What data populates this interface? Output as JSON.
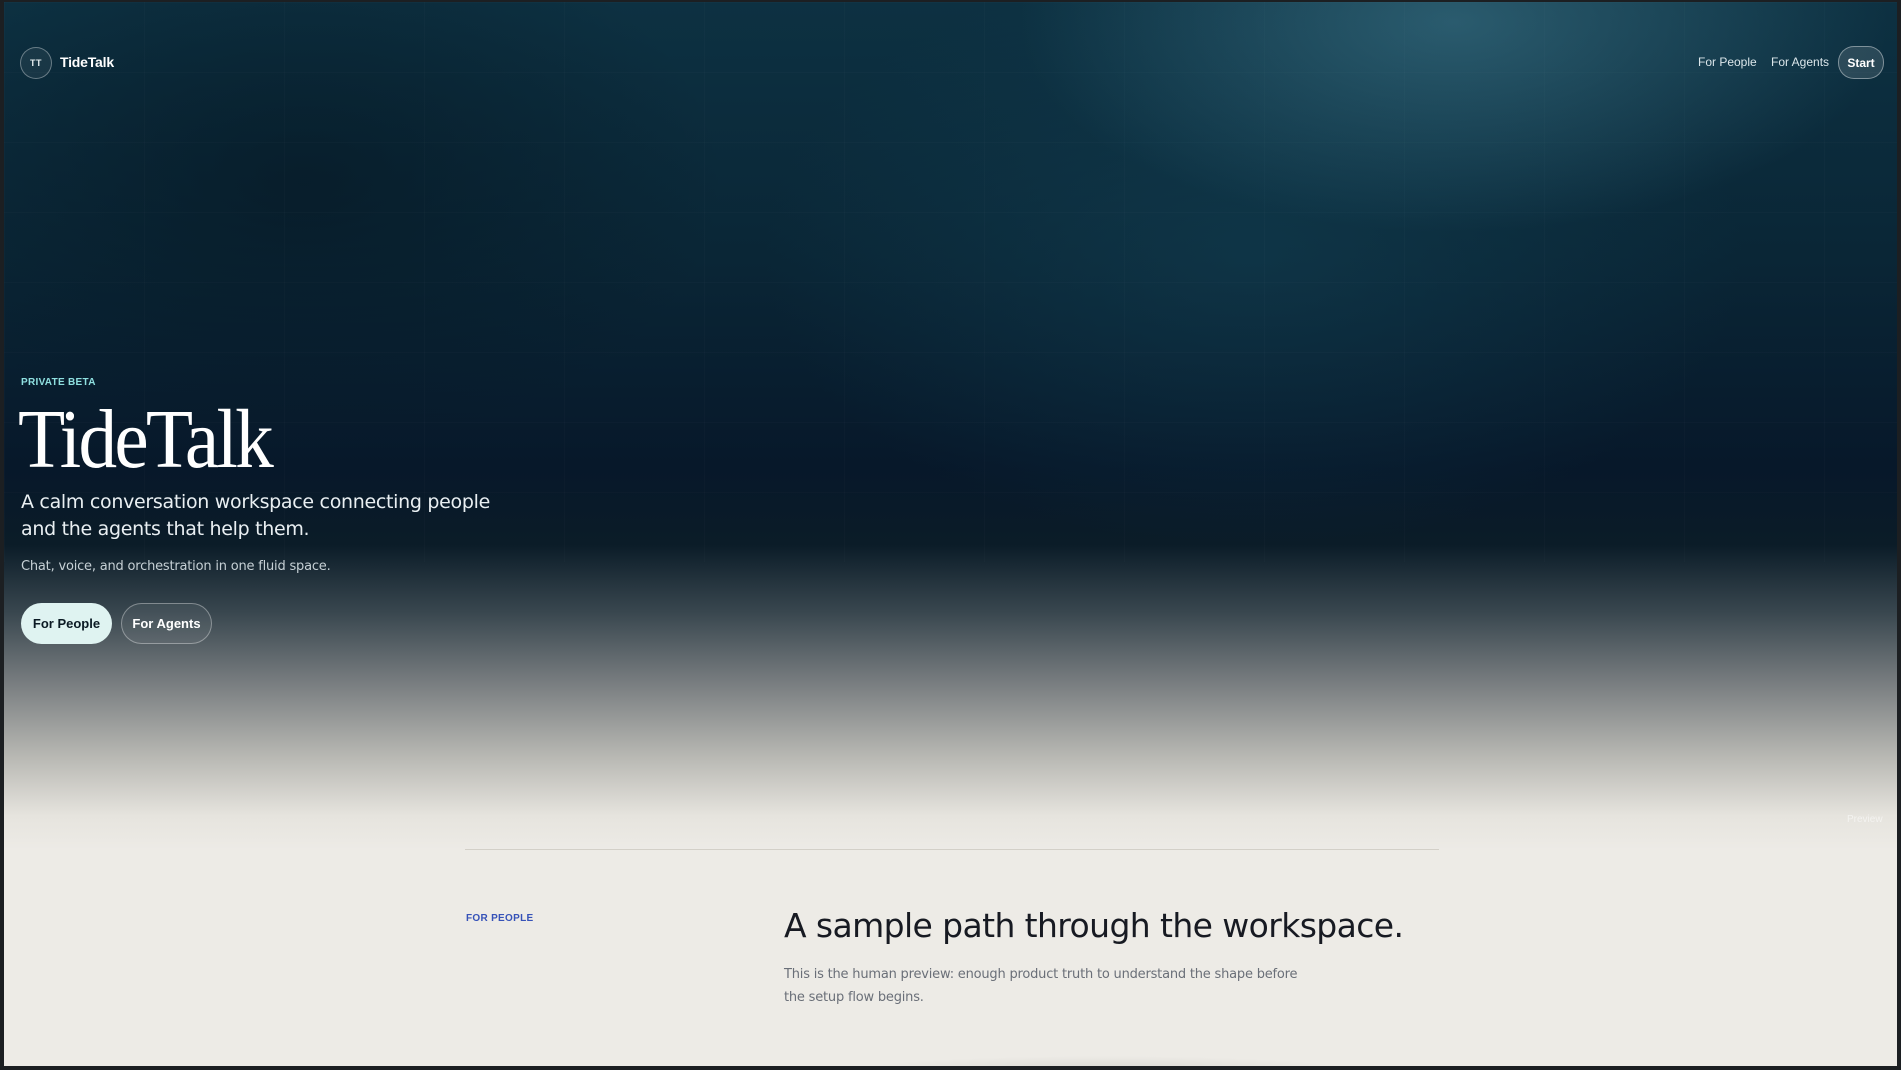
{
  "nav": {
    "logo_initials": "TT",
    "logo_name": "TideTalk",
    "links": [
      "For People",
      "For Agents"
    ],
    "start_label": "Start"
  },
  "hero": {
    "eyebrow": "PRIVATE BETA",
    "title": "TideTalk",
    "subtitle": "A calm conversation workspace connecting people and the agents that help them.",
    "tagline": "Chat, voice, and orchestration in one fluid space.",
    "primary_cta": "For People",
    "secondary_cta": "For Agents",
    "preview_label": "Preview"
  },
  "section": {
    "eyebrow": "FOR PEOPLE",
    "title": "A sample path through the workspace.",
    "body": "This is the human preview: enough product truth to understand the shape before the setup flow begins."
  },
  "colors": {
    "hero_top": "#0d3142",
    "hero_mid": "#07182a",
    "page_bg": "#edebe6",
    "accent_eyebrow": "#8fe0e0",
    "accent_section": "#3652b8",
    "primary_button_bg": "#dff3f1"
  }
}
